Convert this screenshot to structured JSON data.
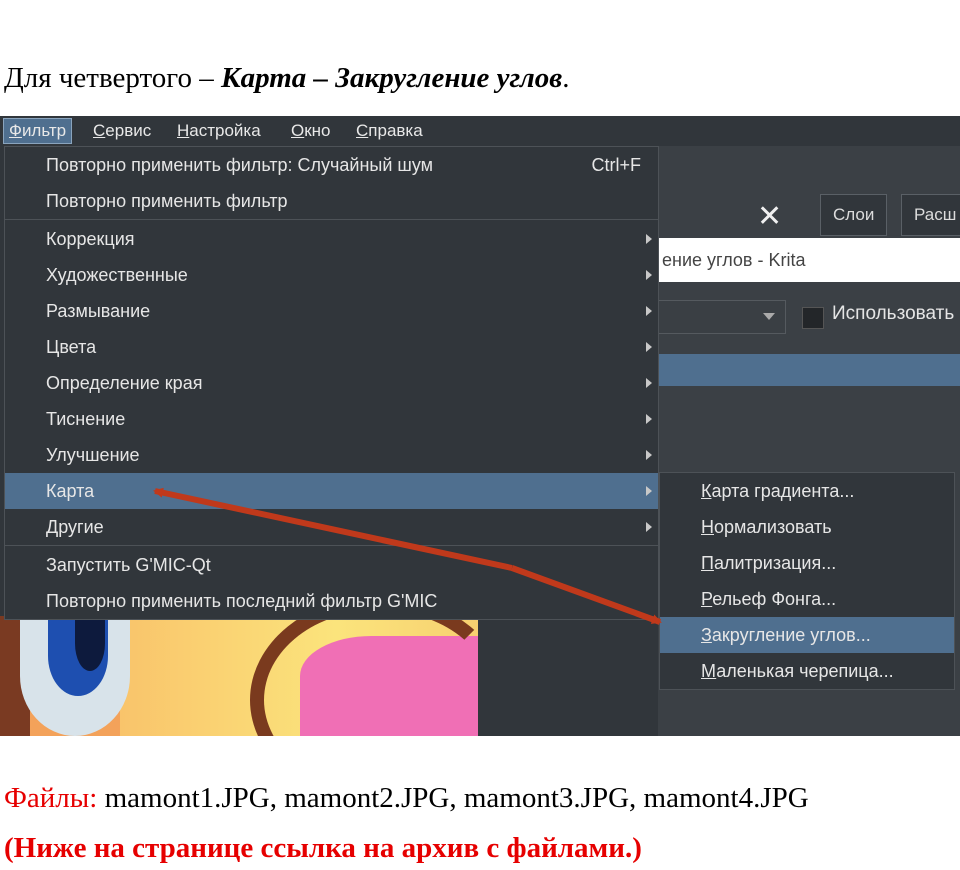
{
  "intro": {
    "prefix": "Для четвертого – ",
    "emphasis": "Карта – Закругление углов",
    "suffix": "."
  },
  "menubar": [
    {
      "text": "Фильтр",
      "accel": "Ф"
    },
    {
      "text": "Сервис",
      "accel": "С"
    },
    {
      "text": "Настройка",
      "accel": "Н"
    },
    {
      "text": "Окно",
      "accel": "О"
    },
    {
      "text": "Справка",
      "accel": "С"
    }
  ],
  "background": {
    "tabs": [
      "Слои",
      "Расш"
    ],
    "title": "ение углов - Krita",
    "checkbox_label": "Использовать"
  },
  "filter_menu": {
    "items": [
      {
        "label": "Повторно применить фильтр: Случайный шум",
        "shortcut": "Ctrl+F"
      },
      {
        "label": "Повторно применить фильтр"
      },
      {
        "label": "Коррекция"
      },
      {
        "label": "Художественные"
      },
      {
        "label": "Размывание"
      },
      {
        "label": "Цвета"
      },
      {
        "label": "Определение края"
      },
      {
        "label": "Тиснение"
      },
      {
        "label": "Улучшение"
      },
      {
        "label": "Карта"
      },
      {
        "label": "Другие"
      },
      {
        "label": "Запустить G'MIC-Qt"
      },
      {
        "label": "Повторно применить последний фильтр G'MIC"
      }
    ]
  },
  "map_submenu": {
    "items": [
      {
        "first": "К",
        "rest": "арта градиента..."
      },
      {
        "first": "Н",
        "rest": "ормализовать"
      },
      {
        "first": "П",
        "rest": "алитризация..."
      },
      {
        "first": "Р",
        "rest": "ельеф Фонга..."
      },
      {
        "first": "З",
        "rest": "акругление углов..."
      },
      {
        "first": "М",
        "rest": "аленькая черепица..."
      }
    ]
  },
  "files": {
    "label": "Файлы:",
    "list": " mamont1.JPG, mamont2.JPG, mamont3.JPG, mamont4.JPG"
  },
  "note": "(Ниже на странице ссылка на архив с файлами.)",
  "colors": {
    "menu_bg": "#31363b",
    "highlight": "#4f6f8f",
    "arrow": "#c0391b",
    "red_text": "#e60000"
  }
}
